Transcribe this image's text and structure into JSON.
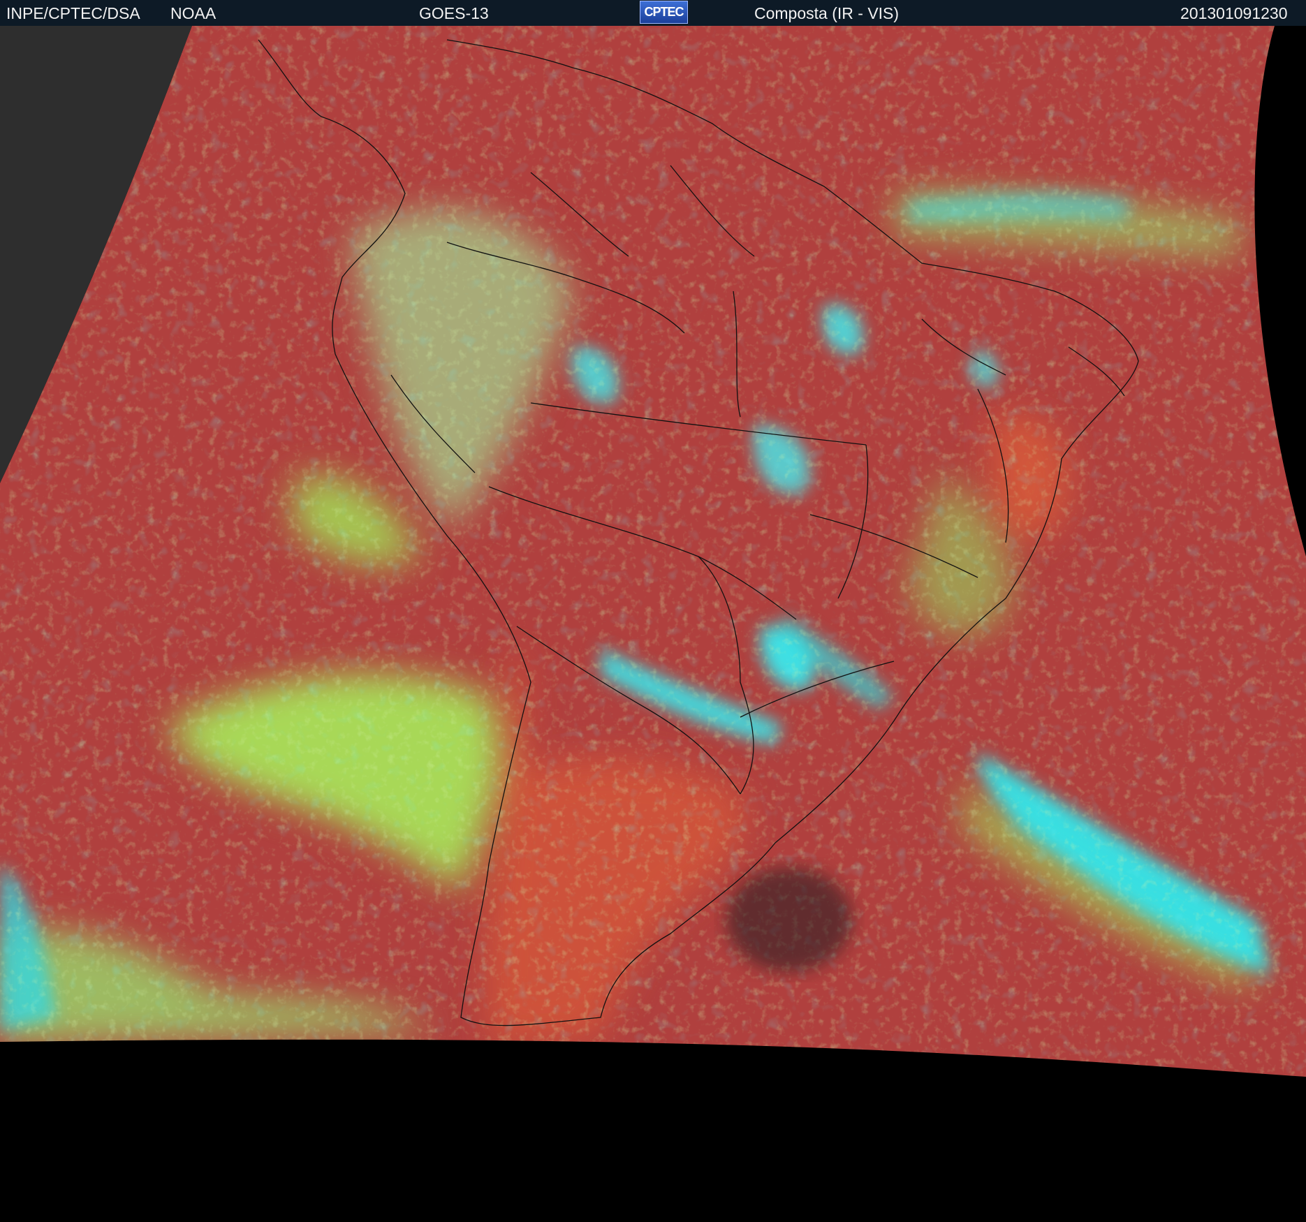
{
  "header": {
    "source": "INPE/CPTEC/DSA",
    "agency": "NOAA",
    "satellite": "GOES-13",
    "logo_text": "CPTEC",
    "product": "Composta (IR - VIS)",
    "timestamp": "201301091230"
  },
  "colors": {
    "header_bg": "#0d1a26",
    "land_surface": "#b0403e",
    "warm_surface": "#d1553a",
    "low_cloud": "#a6e05a",
    "high_cloud": "#32e6e8",
    "outside_disk_left": "#2a2a2a",
    "no_data": "#000000",
    "borders": "#111111"
  }
}
